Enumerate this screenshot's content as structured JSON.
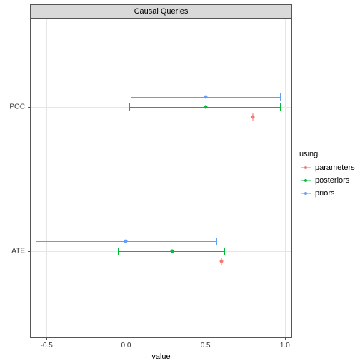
{
  "chart_data": {
    "type": "pointrange-horizontal",
    "facet_title": "Causal Queries",
    "xlabel": "value",
    "ylabel": "",
    "xlim": [
      -0.6,
      1.05
    ],
    "x_ticks": [
      -0.5,
      0.0,
      0.5,
      1.0
    ],
    "y_categories": [
      "ATE",
      "POC"
    ],
    "legend_title": "using",
    "colors": {
      "parameters": "#F8766D",
      "posteriors": "#00BA38",
      "priors": "#619CFF"
    },
    "series": [
      {
        "name": "parameters",
        "color": "#F8766D",
        "points": [
          {
            "y": "POC",
            "x": 0.8,
            "low": 0.8,
            "high": 0.8,
            "offset": -1
          },
          {
            "y": "ATE",
            "x": 0.6,
            "low": 0.6,
            "high": 0.6,
            "offset": -1
          }
        ]
      },
      {
        "name": "posteriors",
        "color": "#00BA38",
        "points": [
          {
            "y": "POC",
            "x": 0.5,
            "low": 0.02,
            "high": 0.97,
            "offset": 0
          },
          {
            "y": "ATE",
            "x": 0.29,
            "low": -0.05,
            "high": 0.62,
            "offset": 0
          }
        ]
      },
      {
        "name": "priors",
        "color": "#619CFF",
        "points": [
          {
            "y": "POC",
            "x": 0.5,
            "low": 0.03,
            "high": 0.97,
            "offset": 1
          },
          {
            "y": "ATE",
            "x": 0.0,
            "low": -0.57,
            "high": 0.57,
            "offset": 1
          }
        ]
      }
    ]
  }
}
